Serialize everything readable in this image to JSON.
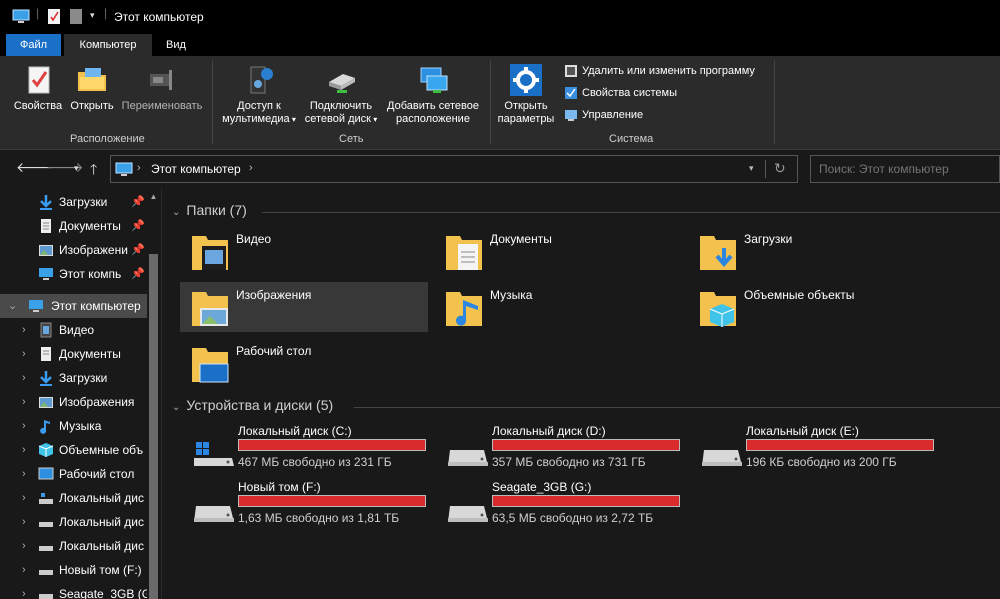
{
  "window": {
    "title": "Этот компьютер"
  },
  "ribbon": {
    "tabs": {
      "file": "Файл",
      "computer": "Компьютер",
      "view": "Вид"
    },
    "buttons": {
      "properties": "Свойства",
      "open": "Открыть",
      "rename": "Переименовать",
      "media_access_1": "Доступ к",
      "media_access_2": "мультимедиа",
      "map_drive_1": "Подключить",
      "map_drive_2": "сетевой диск",
      "add_location_1": "Добавить сетевое",
      "add_location_2": "расположение",
      "open_settings_1": "Открыть",
      "open_settings_2": "параметры",
      "uninstall": "Удалить или изменить программу",
      "system_props": "Свойства системы",
      "manage": "Управление"
    },
    "groups": {
      "location": "Расположение",
      "network": "Сеть",
      "system": "Система"
    }
  },
  "address": {
    "path": "Этот компьютер",
    "search_placeholder": "Поиск: Этот компьютер"
  },
  "sidebar": {
    "quick": [
      {
        "label": "Загрузки"
      },
      {
        "label": "Документы"
      },
      {
        "label": "Изображени"
      },
      {
        "label": "Этот компь"
      }
    ],
    "this_pc": "Этот компьютер",
    "children": [
      {
        "label": "Видео"
      },
      {
        "label": "Документы"
      },
      {
        "label": "Загрузки"
      },
      {
        "label": "Изображения"
      },
      {
        "label": "Музыка"
      },
      {
        "label": "Объемные объ"
      },
      {
        "label": "Рабочий стол"
      },
      {
        "label": "Локальный дис"
      },
      {
        "label": "Локальный дис"
      },
      {
        "label": "Локальный дис"
      },
      {
        "label": "Новый том (F:)"
      },
      {
        "label": "Seagate_3GB (G:"
      }
    ]
  },
  "folders_section": {
    "header": "Папки (7)",
    "items": [
      {
        "label": "Видео",
        "icon": "video-folder-icon"
      },
      {
        "label": "Документы",
        "icon": "documents-folder-icon"
      },
      {
        "label": "Загрузки",
        "icon": "downloads-folder-icon"
      },
      {
        "label": "Изображения",
        "icon": "pictures-folder-icon"
      },
      {
        "label": "Музыка",
        "icon": "music-folder-icon"
      },
      {
        "label": "Объемные объекты",
        "icon": "3d-objects-folder-icon"
      },
      {
        "label": "Рабочий стол",
        "icon": "desktop-folder-icon"
      }
    ]
  },
  "drives_section": {
    "header": "Устройства и диски (5)",
    "items": [
      {
        "name": "Локальный диск (C:)",
        "space": "467 МБ свободно из 231 ГБ",
        "used_fraction": 0.998
      },
      {
        "name": "Локальный диск (D:)",
        "space": "357 МБ свободно из 731 ГБ",
        "used_fraction": 0.999
      },
      {
        "name": "Локальный диск (E:)",
        "space": "196 КБ свободно из 200 ГБ",
        "used_fraction": 0.999
      },
      {
        "name": "Новый том (F:)",
        "space": "1,63 МБ свободно из 1,81 ТБ",
        "used_fraction": 0.999
      },
      {
        "name": "Seagate_3GB (G:)",
        "space": "63,5 МБ свободно из 2,72 ТБ",
        "used_fraction": 0.999
      }
    ]
  },
  "colors": {
    "accent": "#1a6fc7",
    "drive_full": "#d92b2b",
    "background": "#191919",
    "ribbon": "#2b2b2b"
  }
}
